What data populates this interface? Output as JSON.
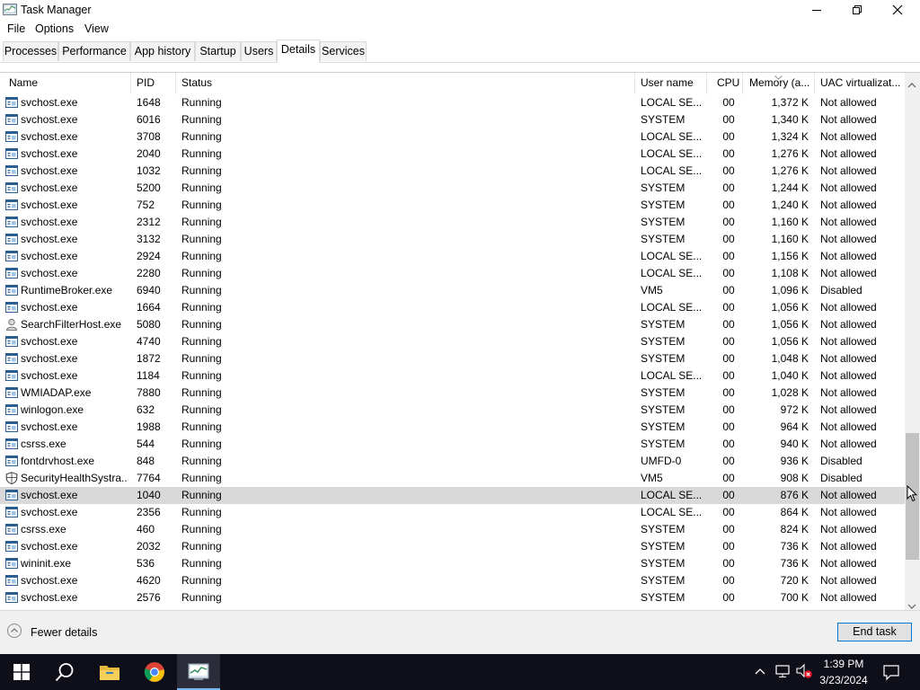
{
  "window": {
    "title": "Task Manager"
  },
  "menu": [
    "File",
    "Options",
    "View"
  ],
  "tabs": [
    "Processes",
    "Performance",
    "App history",
    "Startup",
    "Users",
    "Details",
    "Services"
  ],
  "active_tab": "Details",
  "columns": {
    "name": "Name",
    "pid": "PID",
    "status": "Status",
    "user": "User name",
    "cpu": "CPU",
    "memory": "Memory (a...",
    "uac": "UAC virtualizat..."
  },
  "rows": [
    {
      "icon": "service-icon",
      "name": "svchost.exe",
      "pid": "1648",
      "status": "Running",
      "user": "LOCAL SE...",
      "cpu": "00",
      "memory": "1,372 K",
      "uac": "Not allowed"
    },
    {
      "icon": "service-icon",
      "name": "svchost.exe",
      "pid": "6016",
      "status": "Running",
      "user": "SYSTEM",
      "cpu": "00",
      "memory": "1,340 K",
      "uac": "Not allowed"
    },
    {
      "icon": "service-icon",
      "name": "svchost.exe",
      "pid": "3708",
      "status": "Running",
      "user": "LOCAL SE...",
      "cpu": "00",
      "memory": "1,324 K",
      "uac": "Not allowed"
    },
    {
      "icon": "service-icon",
      "name": "svchost.exe",
      "pid": "2040",
      "status": "Running",
      "user": "LOCAL SE...",
      "cpu": "00",
      "memory": "1,276 K",
      "uac": "Not allowed"
    },
    {
      "icon": "service-icon",
      "name": "svchost.exe",
      "pid": "1032",
      "status": "Running",
      "user": "LOCAL SE...",
      "cpu": "00",
      "memory": "1,276 K",
      "uac": "Not allowed"
    },
    {
      "icon": "service-icon",
      "name": "svchost.exe",
      "pid": "5200",
      "status": "Running",
      "user": "SYSTEM",
      "cpu": "00",
      "memory": "1,244 K",
      "uac": "Not allowed"
    },
    {
      "icon": "service-icon",
      "name": "svchost.exe",
      "pid": "752",
      "status": "Running",
      "user": "SYSTEM",
      "cpu": "00",
      "memory": "1,240 K",
      "uac": "Not allowed"
    },
    {
      "icon": "service-icon",
      "name": "svchost.exe",
      "pid": "2312",
      "status": "Running",
      "user": "SYSTEM",
      "cpu": "00",
      "memory": "1,160 K",
      "uac": "Not allowed"
    },
    {
      "icon": "service-icon",
      "name": "svchost.exe",
      "pid": "3132",
      "status": "Running",
      "user": "SYSTEM",
      "cpu": "00",
      "memory": "1,160 K",
      "uac": "Not allowed"
    },
    {
      "icon": "service-icon",
      "name": "svchost.exe",
      "pid": "2924",
      "status": "Running",
      "user": "LOCAL SE...",
      "cpu": "00",
      "memory": "1,156 K",
      "uac": "Not allowed"
    },
    {
      "icon": "service-icon",
      "name": "svchost.exe",
      "pid": "2280",
      "status": "Running",
      "user": "LOCAL SE...",
      "cpu": "00",
      "memory": "1,108 K",
      "uac": "Not allowed"
    },
    {
      "icon": "service-icon",
      "name": "RuntimeBroker.exe",
      "pid": "6940",
      "status": "Running",
      "user": "VM5",
      "cpu": "00",
      "memory": "1,096 K",
      "uac": "Disabled"
    },
    {
      "icon": "service-icon",
      "name": "svchost.exe",
      "pid": "1664",
      "status": "Running",
      "user": "LOCAL SE...",
      "cpu": "00",
      "memory": "1,056 K",
      "uac": "Not allowed"
    },
    {
      "icon": "search-filter-icon",
      "name": "SearchFilterHost.exe",
      "pid": "5080",
      "status": "Running",
      "user": "SYSTEM",
      "cpu": "00",
      "memory": "1,056 K",
      "uac": "Not allowed"
    },
    {
      "icon": "service-icon",
      "name": "svchost.exe",
      "pid": "4740",
      "status": "Running",
      "user": "SYSTEM",
      "cpu": "00",
      "memory": "1,056 K",
      "uac": "Not allowed"
    },
    {
      "icon": "service-icon",
      "name": "svchost.exe",
      "pid": "1872",
      "status": "Running",
      "user": "SYSTEM",
      "cpu": "00",
      "memory": "1,048 K",
      "uac": "Not allowed"
    },
    {
      "icon": "service-icon",
      "name": "svchost.exe",
      "pid": "1184",
      "status": "Running",
      "user": "LOCAL SE...",
      "cpu": "00",
      "memory": "1,040 K",
      "uac": "Not allowed"
    },
    {
      "icon": "service-icon",
      "name": "WMIADAP.exe",
      "pid": "7880",
      "status": "Running",
      "user": "SYSTEM",
      "cpu": "00",
      "memory": "1,028 K",
      "uac": "Not allowed"
    },
    {
      "icon": "service-icon",
      "name": "winlogon.exe",
      "pid": "632",
      "status": "Running",
      "user": "SYSTEM",
      "cpu": "00",
      "memory": "972 K",
      "uac": "Not allowed"
    },
    {
      "icon": "service-icon",
      "name": "svchost.exe",
      "pid": "1988",
      "status": "Running",
      "user": "SYSTEM",
      "cpu": "00",
      "memory": "964 K",
      "uac": "Not allowed"
    },
    {
      "icon": "service-icon",
      "name": "csrss.exe",
      "pid": "544",
      "status": "Running",
      "user": "SYSTEM",
      "cpu": "00",
      "memory": "940 K",
      "uac": "Not allowed"
    },
    {
      "icon": "service-icon",
      "name": "fontdrvhost.exe",
      "pid": "848",
      "status": "Running",
      "user": "UMFD-0",
      "cpu": "00",
      "memory": "936 K",
      "uac": "Disabled"
    },
    {
      "icon": "shield-icon",
      "name": "SecurityHealthSystra...",
      "pid": "7764",
      "status": "Running",
      "user": "VM5",
      "cpu": "00",
      "memory": "908 K",
      "uac": "Disabled"
    },
    {
      "icon": "service-icon",
      "name": "svchost.exe",
      "pid": "1040",
      "status": "Running",
      "user": "LOCAL SE...",
      "cpu": "00",
      "memory": "876 K",
      "uac": "Not allowed",
      "selected": true
    },
    {
      "icon": "service-icon",
      "name": "svchost.exe",
      "pid": "2356",
      "status": "Running",
      "user": "LOCAL SE...",
      "cpu": "00",
      "memory": "864 K",
      "uac": "Not allowed"
    },
    {
      "icon": "service-icon",
      "name": "csrss.exe",
      "pid": "460",
      "status": "Running",
      "user": "SYSTEM",
      "cpu": "00",
      "memory": "824 K",
      "uac": "Not allowed"
    },
    {
      "icon": "service-icon",
      "name": "svchost.exe",
      "pid": "2032",
      "status": "Running",
      "user": "SYSTEM",
      "cpu": "00",
      "memory": "736 K",
      "uac": "Not allowed"
    },
    {
      "icon": "service-icon",
      "name": "wininit.exe",
      "pid": "536",
      "status": "Running",
      "user": "SYSTEM",
      "cpu": "00",
      "memory": "736 K",
      "uac": "Not allowed"
    },
    {
      "icon": "service-icon",
      "name": "svchost.exe",
      "pid": "4620",
      "status": "Running",
      "user": "SYSTEM",
      "cpu": "00",
      "memory": "720 K",
      "uac": "Not allowed"
    },
    {
      "icon": "service-icon",
      "name": "svchost.exe",
      "pid": "2576",
      "status": "Running",
      "user": "SYSTEM",
      "cpu": "00",
      "memory": "700 K",
      "uac": "Not allowed"
    }
  ],
  "footer": {
    "fewer_details": "Fewer details",
    "end_task": "End task"
  },
  "taskbar": {
    "time": "1:39 PM",
    "date": "3/23/2024"
  },
  "colors": {
    "selected_row": "#d9d9d9",
    "accent": "#0078d7",
    "taskbar": "#0f0f1a"
  }
}
